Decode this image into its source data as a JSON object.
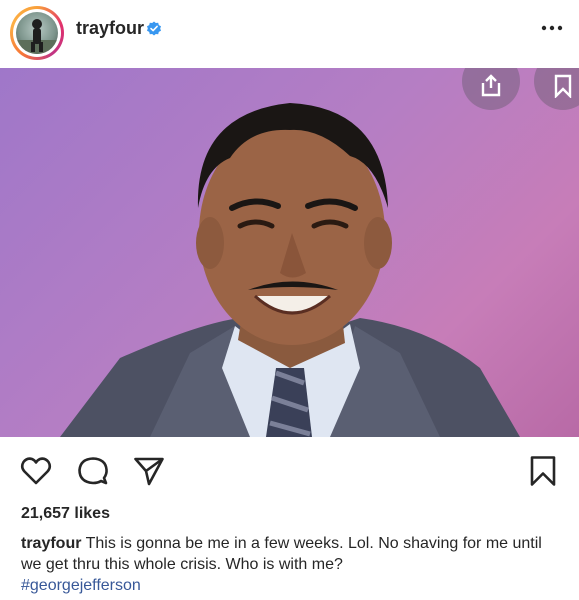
{
  "post": {
    "username": "trayfour",
    "likes": "21,657 likes",
    "caption_user": "trayfour",
    "caption_text": "This is gonna be me in a few weeks. Lol. No shaving for me until we get thru this whole crisis. Who is with me?",
    "hashtag": "#georgejefferson"
  },
  "colors": {
    "text": "#262626",
    "hashtag": "#385898",
    "verified": "#3897f0",
    "photo_background": "#b57ec4"
  },
  "icons": {
    "verified": "verified-badge-icon",
    "more": "more-options-icon",
    "like": "heart-icon",
    "comment": "comment-bubble-icon",
    "share": "paper-plane-icon",
    "save": "bookmark-icon",
    "overlay_share": "share-out-icon",
    "overlay_save": "bookmark-icon"
  }
}
